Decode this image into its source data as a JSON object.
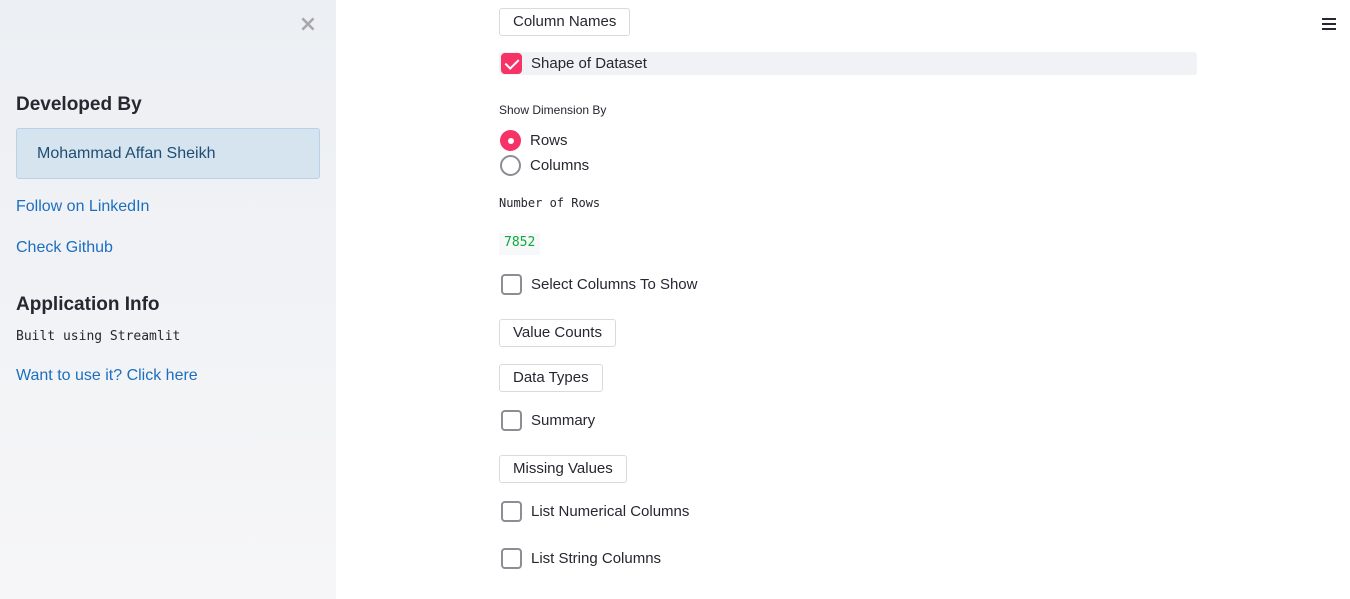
{
  "sidebar": {
    "close_icon": "×",
    "developed_heading": "Developed By",
    "developer_name": "Mohammad Affan Sheikh",
    "link_linkedin": "Follow on LinkedIn",
    "link_github": "Check Github",
    "app_info_heading": "Application Info",
    "built_text": "Built using Streamlit",
    "link_use": "Want to use it? Click here"
  },
  "main": {
    "column_names_button": "Column Names",
    "shape_checkbox": {
      "label": "Shape of Dataset",
      "checked": true
    },
    "dimension_label": "Show Dimension By",
    "dimension_options": [
      {
        "label": "Rows",
        "selected": true
      },
      {
        "label": "Columns",
        "selected": false
      }
    ],
    "rows_label": "Number of Rows",
    "rows_value": "7852",
    "select_columns_checkbox": {
      "label": "Select Columns To Show",
      "checked": false
    },
    "value_counts_button": "Value Counts",
    "data_types_button": "Data Types",
    "summary_checkbox": {
      "label": "Summary",
      "checked": false
    },
    "missing_values_button": "Missing Values",
    "numerical_checkbox": {
      "label": "List Numerical Columns",
      "checked": false
    },
    "string_checkbox": {
      "label": "List String Columns",
      "checked": false
    }
  },
  "colors": {
    "accent": "#f63366",
    "link": "#1c6fbf",
    "info_bg": "#d6e4f0",
    "code_green": "#09ab3b"
  },
  "icons": {
    "close": "close-icon",
    "menu": "hamburger-menu-icon",
    "checkbox_checked": "checkmark-icon"
  }
}
